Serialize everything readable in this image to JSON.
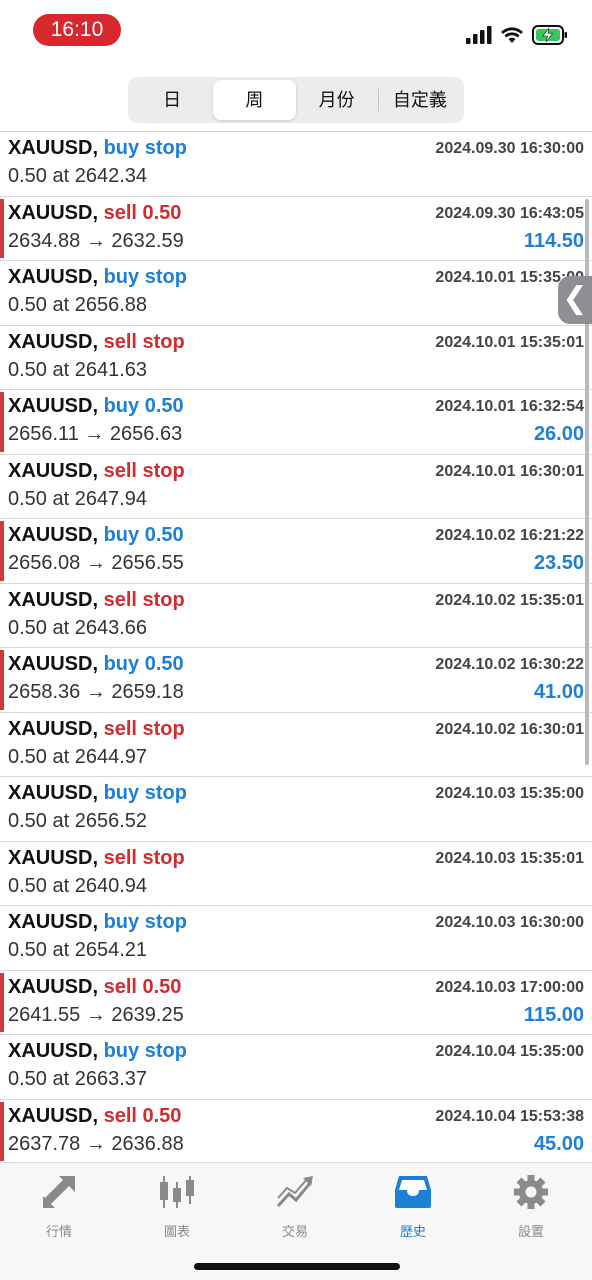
{
  "status": {
    "time": "16:10"
  },
  "segments": [
    {
      "label": "日",
      "active": false
    },
    {
      "label": "周",
      "active": true
    },
    {
      "label": "月份",
      "active": false
    },
    {
      "label": "自定義",
      "active": false
    }
  ],
  "rows": [
    {
      "symbol": "XAUUSD,",
      "type": "buy stop",
      "side": "buy",
      "detail": "0.50 at 2642.34",
      "time": "2024.09.30 16:30:00",
      "profit": ""
    },
    {
      "symbol": "XAUUSD,",
      "type": "sell 0.50",
      "side": "sell",
      "detail": "2634.88 → 2632.59",
      "time": "2024.09.30 16:43:05",
      "profit": "114.50"
    },
    {
      "symbol": "XAUUSD,",
      "type": "buy stop",
      "side": "buy",
      "detail": "0.50 at 2656.88",
      "time": "2024.10.01 15:35:00",
      "profit": ""
    },
    {
      "symbol": "XAUUSD,",
      "type": "sell stop",
      "side": "sell",
      "detail": "0.50 at 2641.63",
      "time": "2024.10.01 15:35:01",
      "profit": ""
    },
    {
      "symbol": "XAUUSD,",
      "type": "buy 0.50",
      "side": "buy",
      "detail": "2656.11 → 2656.63",
      "time": "2024.10.01 16:32:54",
      "profit": "26.00"
    },
    {
      "symbol": "XAUUSD,",
      "type": "sell stop",
      "side": "sell",
      "detail": "0.50 at 2647.94",
      "time": "2024.10.01 16:30:01",
      "profit": ""
    },
    {
      "symbol": "XAUUSD,",
      "type": "buy 0.50",
      "side": "buy",
      "detail": "2656.08 → 2656.55",
      "time": "2024.10.02 16:21:22",
      "profit": "23.50"
    },
    {
      "symbol": "XAUUSD,",
      "type": "sell stop",
      "side": "sell",
      "detail": "0.50 at 2643.66",
      "time": "2024.10.02 15:35:01",
      "profit": ""
    },
    {
      "symbol": "XAUUSD,",
      "type": "buy 0.50",
      "side": "buy",
      "detail": "2658.36 → 2659.18",
      "time": "2024.10.02 16:30:22",
      "profit": "41.00"
    },
    {
      "symbol": "XAUUSD,",
      "type": "sell stop",
      "side": "sell",
      "detail": "0.50 at 2644.97",
      "time": "2024.10.02 16:30:01",
      "profit": ""
    },
    {
      "symbol": "XAUUSD,",
      "type": "buy stop",
      "side": "buy",
      "detail": "0.50 at 2656.52",
      "time": "2024.10.03 15:35:00",
      "profit": ""
    },
    {
      "symbol": "XAUUSD,",
      "type": "sell stop",
      "side": "sell",
      "detail": "0.50 at 2640.94",
      "time": "2024.10.03 15:35:01",
      "profit": ""
    },
    {
      "symbol": "XAUUSD,",
      "type": "buy stop",
      "side": "buy",
      "detail": "0.50 at 2654.21",
      "time": "2024.10.03 16:30:00",
      "profit": ""
    },
    {
      "symbol": "XAUUSD,",
      "type": "sell 0.50",
      "side": "sell",
      "detail": "2641.55 → 2639.25",
      "time": "2024.10.03 17:00:00",
      "profit": "115.00"
    },
    {
      "symbol": "XAUUSD,",
      "type": "buy stop",
      "side": "buy",
      "detail": "0.50 at 2663.37",
      "time": "2024.10.04 15:35:00",
      "profit": ""
    },
    {
      "symbol": "XAUUSD,",
      "type": "sell 0.50",
      "side": "sell",
      "detail": "2637.78 → 2636.88",
      "time": "2024.10.04 15:53:38",
      "profit": "45.00"
    }
  ],
  "tabbar": [
    {
      "label": "行情",
      "icon": "quotes-arrows-icon",
      "active": false
    },
    {
      "label": "圖表",
      "icon": "candlestick-chart-icon",
      "active": false
    },
    {
      "label": "交易",
      "icon": "trade-trend-icon",
      "active": false
    },
    {
      "label": "歷史",
      "icon": "history-inbox-icon",
      "active": true
    },
    {
      "label": "設置",
      "icon": "settings-gear-icon",
      "active": false
    }
  ],
  "colors": {
    "accent": "#1e7fd6",
    "sell": "#d22c2f",
    "deal_bar": "#d03a3f",
    "time_pill": "#d9272e"
  }
}
